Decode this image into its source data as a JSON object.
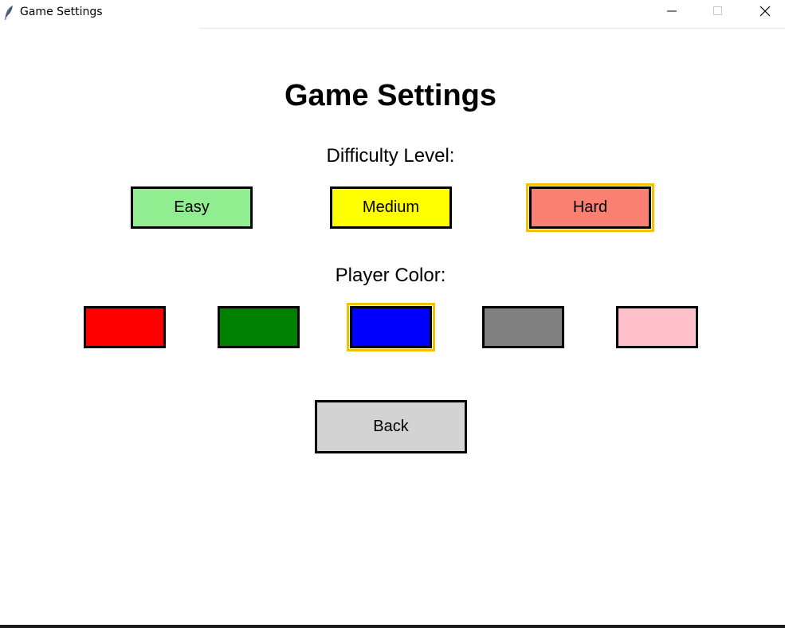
{
  "window": {
    "title": "Game Settings",
    "app_icon": "feather-icon",
    "controls": {
      "minimize_icon": "minimize-icon",
      "maximize_icon": "maximize-icon",
      "close_icon": "close-icon"
    }
  },
  "main": {
    "heading": "Game Settings",
    "difficulty": {
      "label": "Difficulty Level:",
      "options": [
        {
          "label": "Easy",
          "color": "#90ee90"
        },
        {
          "label": "Medium",
          "color": "#ffff00"
        },
        {
          "label": "Hard",
          "color": "#fa8072"
        }
      ],
      "selected": "Hard"
    },
    "player_color": {
      "label": "Player Color:",
      "swatches": [
        {
          "name": "red",
          "color": "#ff0000"
        },
        {
          "name": "green",
          "color": "#008000"
        },
        {
          "name": "blue",
          "color": "#0000ff"
        },
        {
          "name": "gray",
          "color": "#808080"
        },
        {
          "name": "pink",
          "color": "#ffc0cb"
        }
      ],
      "selected": "blue"
    },
    "back_label": "Back"
  },
  "colors": {
    "selection_highlight": "#f2c200",
    "back_button": "#d3d3d3"
  }
}
